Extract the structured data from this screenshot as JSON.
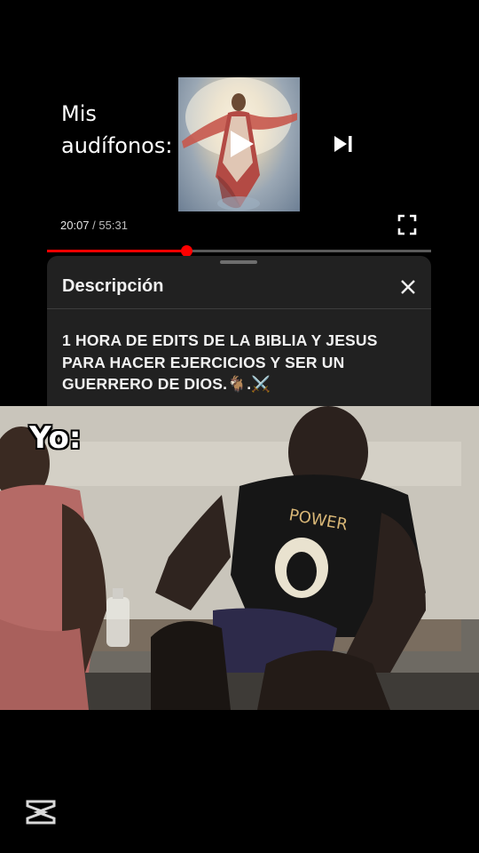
{
  "meme": {
    "caption_top_line1": "Mis",
    "caption_top_line2": "audífonos:",
    "caption_bottom": "Yo:"
  },
  "player": {
    "current_time": "20:07",
    "separator": " / ",
    "total_time": "55:31",
    "progress_fraction": 0.363,
    "accent_color": "#ff0000",
    "controls": [
      "play-icon",
      "skip-next-icon",
      "fullscreen-icon"
    ]
  },
  "description_sheet": {
    "title": "Descripción",
    "close_icon": "close-icon",
    "text": "1 HORA DE EDITS DE LA BIBLIA Y JESUS PARA HACER EJERCICIOS Y SER UN GUERRERO DE DIOS.🐐.⚔️"
  },
  "watermark": {
    "icon": "capcut-logo-icon"
  }
}
